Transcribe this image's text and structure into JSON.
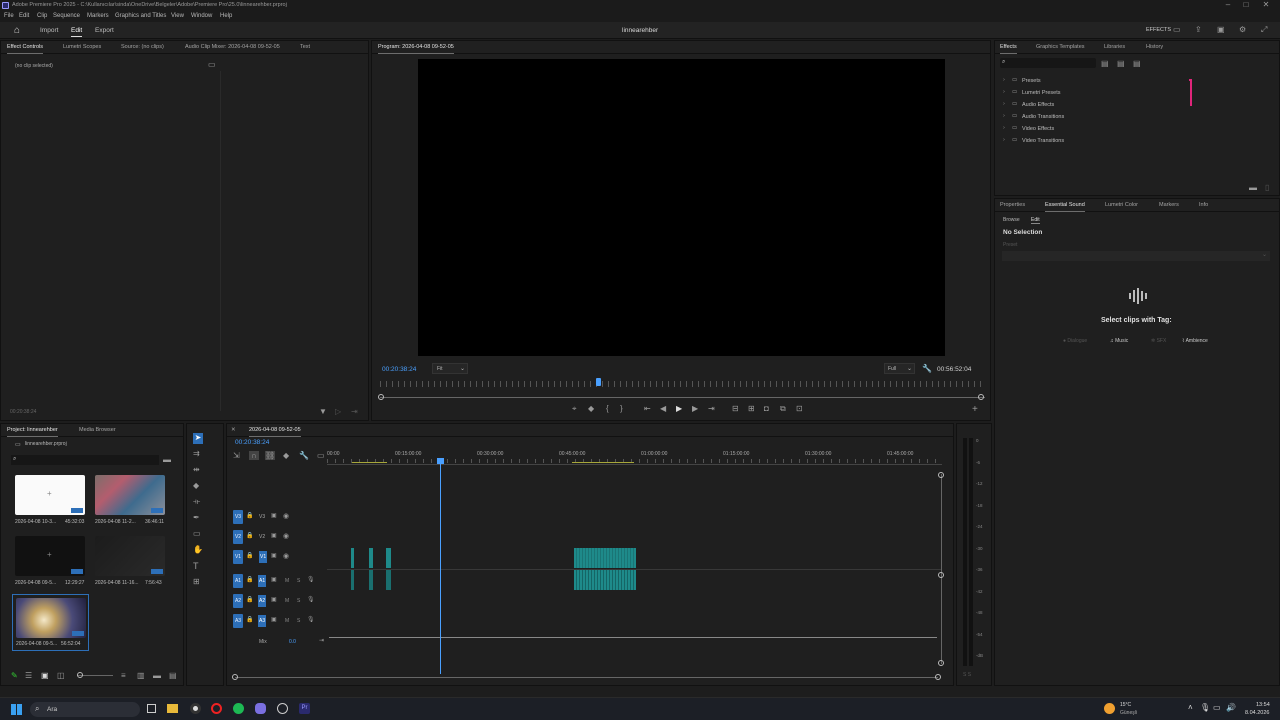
{
  "window": {
    "title": "Adobe Premiere Pro 2025 - C:\\Kullanıcılar\\sinda\\OneDrive\\Belgeler\\Adobe\\Premiere Pro\\25.0\\linnearehber.prproj"
  },
  "menu": [
    "File",
    "Edit",
    "Clip",
    "Sequence",
    "Markers",
    "Graphics and Titles",
    "View",
    "Window",
    "Help"
  ],
  "workspace": {
    "tabs": [
      "Import",
      "Edit",
      "Export"
    ],
    "active": "Edit",
    "project_name": "linnearehber",
    "effects_label": "EFFECTS"
  },
  "source_panel": {
    "tabs": [
      "Effect Controls",
      "Lumetri Scopes",
      "Source: (no clips)",
      "Audio Clip Mixer: 2026-04-08 09-52-05",
      "Text"
    ],
    "empty": "(no clip selected)",
    "timecode": "00:20:38:24"
  },
  "program": {
    "title": "Program: 2026-04-08 09-52-05",
    "timecode": "00:20:38:24",
    "fit": "Fit",
    "quality": "Full",
    "duration": "00:56:52:04",
    "playhead_fraction": 0.36
  },
  "effects": {
    "tabs": [
      "Effects",
      "Graphics Templates",
      "Libraries",
      "History"
    ],
    "folders": [
      "Presets",
      "Lumetri Presets",
      "Audio Effects",
      "Audio Transitions",
      "Video Effects",
      "Video Transitions"
    ]
  },
  "essential_sound": {
    "tabs": [
      "Properties",
      "Essential Sound",
      "Lumetri Color",
      "Markers",
      "Info"
    ],
    "subtabs": [
      "Browse",
      "Edit"
    ],
    "no_selection": "No Selection",
    "preset": "Preset",
    "select_text": "Select clips with Tag:",
    "tags": [
      "Dialogue",
      "Music",
      "SFX",
      "Ambience"
    ]
  },
  "project": {
    "tabs": [
      "Project: linnearehber",
      "Media Browser"
    ],
    "file": "linnearehber.prproj",
    "clips": [
      {
        "name": "2026-04-08 10-3...",
        "duration": "45:32:03",
        "kind": "white"
      },
      {
        "name": "2026-04-08 11-2...",
        "duration": "36:46:11",
        "kind": "game"
      },
      {
        "name": "2026-04-08 09-5...",
        "duration": "12:29:27",
        "kind": "dark"
      },
      {
        "name": "2026-04-08 11-16...",
        "duration": "7:56:43",
        "kind": "dark2"
      },
      {
        "name": "2026-04-08 09-5...",
        "duration": "56:52:04",
        "kind": "game2"
      }
    ]
  },
  "timeline": {
    "title": "2026-04-08 09-52-05",
    "timecode": "00:20:38:24",
    "ruler": [
      "00:00",
      "00:15:00:00",
      "00:30:00:00",
      "00:45:00:00",
      "01:00:00:00",
      "01:15:00:00",
      "01:30:00:00",
      "01:45:00:00"
    ],
    "video_tracks": [
      "V3",
      "V2",
      "V1"
    ],
    "audio_tracks": [
      "A1",
      "A2",
      "A3"
    ],
    "mix_label": "Mix",
    "mix_value": "0.0"
  },
  "meters": [
    "0",
    "-6",
    "-12",
    "-18",
    "-24",
    "-30",
    "-36",
    "-42",
    "-48",
    "-54",
    "-dB"
  ],
  "meter_footer": "S S",
  "taskbar": {
    "search": "Ara",
    "weather_temp": "15°C",
    "weather_desc": "Güneşli",
    "time": "13:54",
    "date": "8.04.2026"
  },
  "colors": {
    "accent": "#2d6fb8",
    "timecode": "#4aa0ff",
    "clip": "#1e8a8a"
  }
}
